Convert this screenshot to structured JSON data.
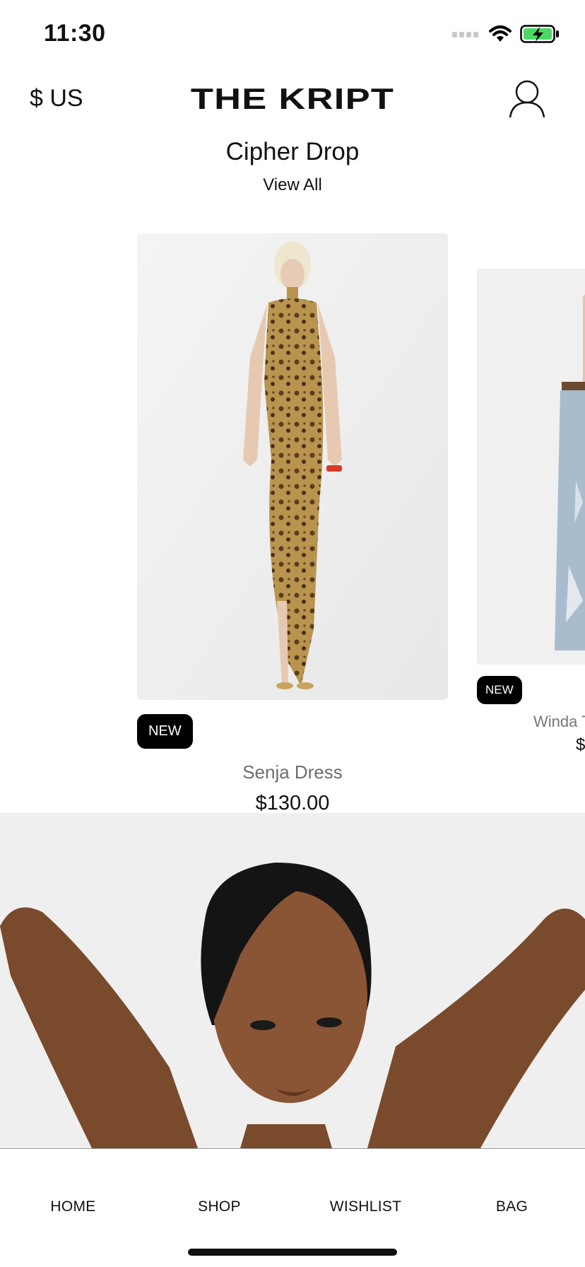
{
  "status_bar": {
    "time": "11:30"
  },
  "header": {
    "currency": "$ US",
    "brand": "THE KRIPT"
  },
  "section": {
    "title": "Cipher Drop",
    "view_all": "View All"
  },
  "products": [
    {
      "badge": "NEW",
      "name": "Senja Dress",
      "price": "$130.00"
    },
    {
      "badge": "NEW",
      "name": "Winda T",
      "price": "$"
    }
  ],
  "tabs": [
    {
      "label": "HOME"
    },
    {
      "label": "SHOP"
    },
    {
      "label": "WISHLIST"
    },
    {
      "label": "BAG"
    }
  ],
  "colors": {
    "accent": "#000000",
    "battery": "#4cd964",
    "name_gray": "#6e6e6e"
  }
}
